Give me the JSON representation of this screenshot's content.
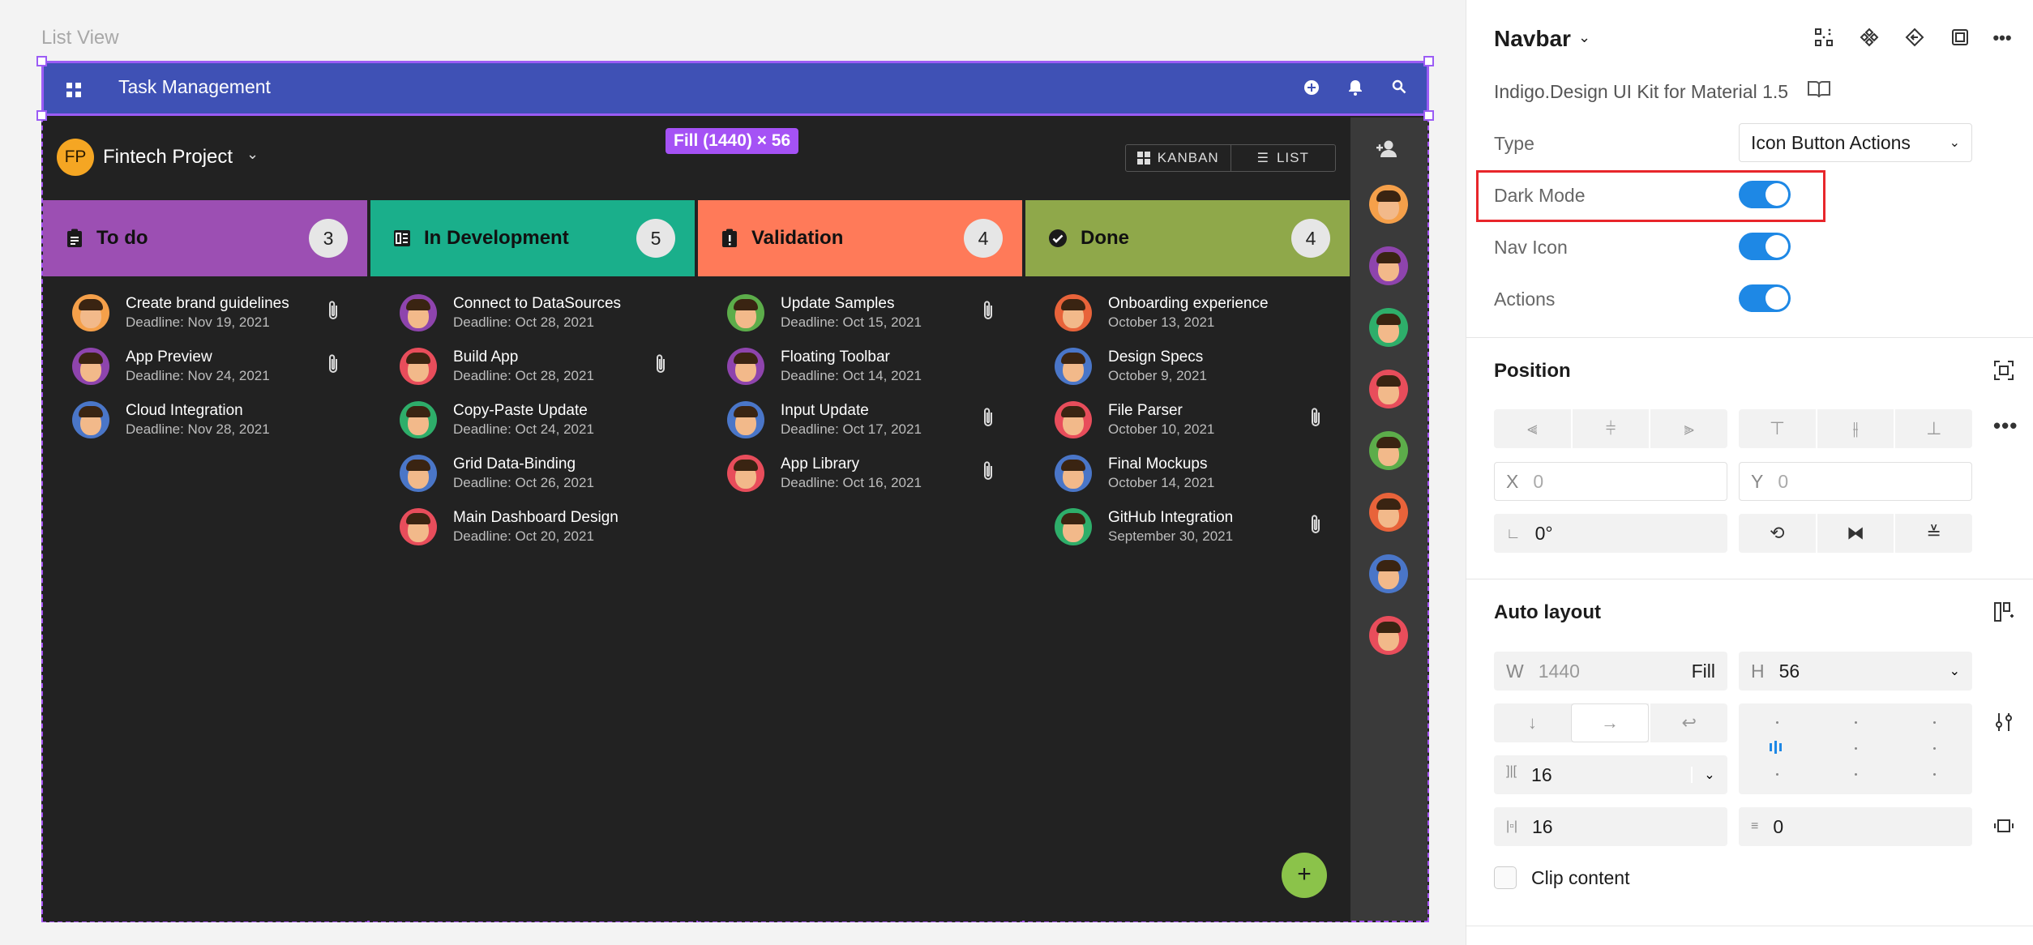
{
  "canvas": {
    "frame_label": "List View",
    "navbar": {
      "title": "Task Management",
      "actions": [
        "add-circle-icon",
        "bell-icon",
        "search-icon"
      ],
      "color": "#3f51b5"
    },
    "size_badge": "Fill (1440) × 56",
    "project": {
      "initials": "FP",
      "name": "Fintech Project"
    },
    "view_toggle": {
      "kanban": "KANBAN",
      "list": "LIST"
    },
    "columns": [
      {
        "title": "To do",
        "count": "3",
        "color": "#9c4fb3",
        "icon": "clipboard-icon",
        "cards": [
          {
            "title": "Create brand guidelines",
            "sub": "Deadline: Nov 19, 2021",
            "clip": true,
            "avatar": "#f5a04a"
          },
          {
            "title": "App Preview",
            "sub": "Deadline: Nov 24, 2021",
            "clip": true,
            "avatar": "#8e44ad"
          },
          {
            "title": "Cloud Integration",
            "sub": "Deadline: Nov 28, 2021",
            "clip": false,
            "avatar": "#4a76c8"
          }
        ]
      },
      {
        "title": "In Development",
        "count": "5",
        "color": "#1aaf8b",
        "icon": "code-icon",
        "cards": [
          {
            "title": "Connect to DataSources",
            "sub": "Deadline: Oct 28, 2021",
            "clip": false,
            "avatar": "#8e44ad"
          },
          {
            "title": "Build App",
            "sub": "Deadline: Oct 28, 2021",
            "clip": true,
            "avatar": "#e84d5b"
          },
          {
            "title": "Copy-Paste Update",
            "sub": "Deadline: Oct 24, 2021",
            "clip": false,
            "avatar": "#2eae6a"
          },
          {
            "title": "Grid Data-Binding",
            "sub": "Deadline: Oct 26, 2021",
            "clip": false,
            "avatar": "#4a76c8"
          },
          {
            "title": "Main Dashboard Design",
            "sub": "Deadline: Oct 20, 2021",
            "clip": false,
            "avatar": "#e84d5b"
          }
        ]
      },
      {
        "title": "Validation",
        "count": "4",
        "color": "#ff7a59",
        "icon": "alert-clipboard-icon",
        "cards": [
          {
            "title": "Update Samples",
            "sub": "Deadline: Oct 15, 2021",
            "clip": true,
            "avatar": "#5cad4a"
          },
          {
            "title": "Floating Toolbar",
            "sub": "Deadline: Oct 14, 2021",
            "clip": false,
            "avatar": "#8e44ad"
          },
          {
            "title": "Input Update",
            "sub": "Deadline: Oct 17, 2021",
            "clip": true,
            "avatar": "#4a76c8"
          },
          {
            "title": "App Library",
            "sub": "Deadline: Oct 16, 2021",
            "clip": true,
            "avatar": "#e84d5b"
          }
        ]
      },
      {
        "title": "Done",
        "count": "4",
        "color": "#8fa84a",
        "icon": "check-circle-icon",
        "cards": [
          {
            "title": "Onboarding experience",
            "sub": "October 13, 2021",
            "clip": false,
            "avatar": "#e8633a"
          },
          {
            "title": "Design Specs",
            "sub": "October 9, 2021",
            "clip": false,
            "avatar": "#4a76c8"
          },
          {
            "title": "File Parser",
            "sub": "October 10, 2021",
            "clip": true,
            "avatar": "#e84d5b"
          },
          {
            "title": "Final Mockups",
            "sub": "October 14, 2021",
            "clip": false,
            "avatar": "#4a76c8"
          },
          {
            "title": "GitHub Integration",
            "sub": "September 30, 2021",
            "clip": true,
            "avatar": "#2eae6a"
          }
        ]
      }
    ],
    "rail_avatars": [
      "#f5a04a",
      "#8e44ad",
      "#2eae6a",
      "#e84d5b",
      "#5cad4a",
      "#e8633a",
      "#4a76c8",
      "#e84d5b"
    ],
    "fab_icon": "plus-icon"
  },
  "panel": {
    "title": "Navbar",
    "kit": "Indigo.Design UI Kit for Material 1.5",
    "type_label": "Type",
    "type_value": "Icon Button Actions",
    "toggles": [
      {
        "label": "Dark Mode",
        "on": true
      },
      {
        "label": "Nav Icon",
        "on": true
      },
      {
        "label": "Actions",
        "on": true
      }
    ],
    "position": {
      "title": "Position",
      "x_label": "X",
      "x_value": "0",
      "y_label": "Y",
      "y_value": "0",
      "rotation": "0°"
    },
    "auto_layout": {
      "title": "Auto layout",
      "w_label": "W",
      "w_value": "1440",
      "w_mode": "Fill",
      "h_label": "H",
      "h_value": "56",
      "spacing": "16",
      "padding_h": "16",
      "padding_v": "0"
    },
    "clip_content": "Clip content",
    "accent": "#1e88e5",
    "highlight": "#e8262b"
  }
}
